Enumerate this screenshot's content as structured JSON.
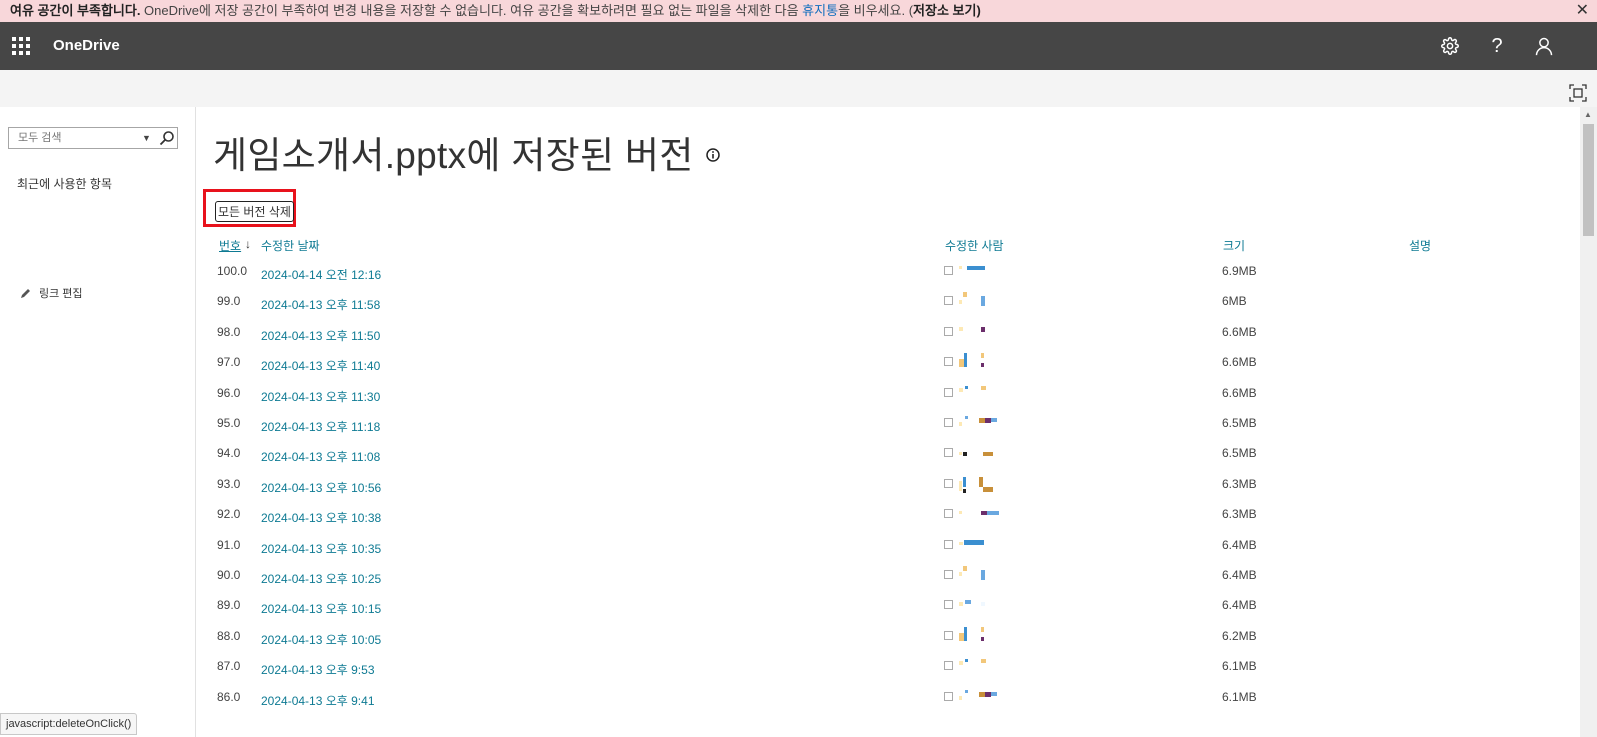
{
  "banner": {
    "bold": "여유 공간이 부족합니다.",
    "part1": " OneDrive에 저장 공간이 부족하여 변경 내용을 저장할 수 없습니다. 여유 공간을 확보하려면 필요 없는 파일을 삭제한 다음 ",
    "link_recycle": "휴지통",
    "part2": "을 비우세요. (",
    "link_storage": "저장소 보기",
    "part3": ")",
    "close_icon": "✕"
  },
  "suite": {
    "brand": "OneDrive",
    "help": "?"
  },
  "leftnav": {
    "search_placeholder": "모두 검색",
    "recent": "최근에 사용한 항목",
    "edit_links": "링크 편집"
  },
  "main": {
    "title": "게임소개서.pptx에 저장된 버전",
    "delete_all": "모든 버전 삭제",
    "headers": {
      "number": "번호",
      "sort_arrow": "↓",
      "modified": "수정한 날짜",
      "modified_by": "수정한 사람",
      "size": "크기",
      "comments": "설명"
    },
    "rows": [
      {
        "no": "100.0",
        "date": "2024-04-14 오전 12:16",
        "size": "6.9MB"
      },
      {
        "no": "99.0",
        "date": "2024-04-13 오후 11:58",
        "size": "6MB"
      },
      {
        "no": "98.0",
        "date": "2024-04-13 오후 11:50",
        "size": "6.6MB"
      },
      {
        "no": "97.0",
        "date": "2024-04-13 오후 11:40",
        "size": "6.6MB"
      },
      {
        "no": "96.0",
        "date": "2024-04-13 오후 11:30",
        "size": "6.6MB"
      },
      {
        "no": "95.0",
        "date": "2024-04-13 오후 11:18",
        "size": "6.5MB"
      },
      {
        "no": "94.0",
        "date": "2024-04-13 오후 11:08",
        "size": "6.5MB"
      },
      {
        "no": "93.0",
        "date": "2024-04-13 오후 10:56",
        "size": "6.3MB"
      },
      {
        "no": "92.0",
        "date": "2024-04-13 오후 10:38",
        "size": "6.3MB"
      },
      {
        "no": "91.0",
        "date": "2024-04-13 오후 10:35",
        "size": "6.4MB"
      },
      {
        "no": "90.0",
        "date": "2024-04-13 오후 10:25",
        "size": "6.4MB"
      },
      {
        "no": "89.0",
        "date": "2024-04-13 오후 10:15",
        "size": "6.4MB"
      },
      {
        "no": "88.0",
        "date": "2024-04-13 오후 10:05",
        "size": "6.2MB"
      },
      {
        "no": "87.0",
        "date": "2024-04-13 오후 9:53",
        "size": "6.1MB"
      },
      {
        "no": "86.0",
        "date": "2024-04-13 오후 9:41",
        "size": "6.1MB"
      }
    ]
  },
  "status": "javascript:deleteOnClick()",
  "colors": {
    "banner_bg": "#f8d7da",
    "suite_bg": "#464646",
    "link": "#0e7a93",
    "highlight": "#e8121c"
  }
}
